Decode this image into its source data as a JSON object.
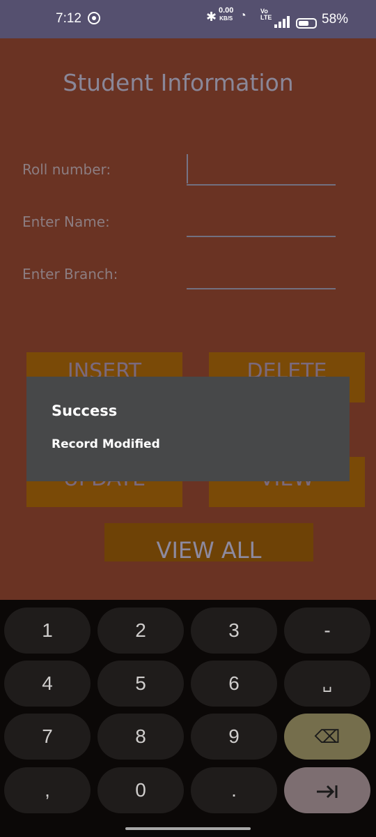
{
  "status_bar": {
    "time": "7:12",
    "net_speed_value": "0.00",
    "net_speed_unit": "KB/S",
    "volte_top": "Vo",
    "volte_bottom": "LTE",
    "battery": "58%"
  },
  "app": {
    "title": "Student Information",
    "fields": [
      {
        "label": "Roll number:",
        "value": ""
      },
      {
        "label": "Enter Name:",
        "value": ""
      },
      {
        "label": "Enter Branch:",
        "value": ""
      }
    ],
    "buttons": {
      "insert": "INSERT",
      "delete": "DELETE",
      "update": "UPDATE",
      "view": "VIEW",
      "view_all": "VIEW ALL"
    }
  },
  "dialog": {
    "title": "Success",
    "message": "Record Modified"
  },
  "keyboard": {
    "keys": [
      "1",
      "2",
      "3",
      "-",
      "4",
      "5",
      "6",
      "␣",
      "7",
      "8",
      "9",
      "⌫",
      ",",
      "0",
      "."
    ]
  },
  "colors": {
    "status_bar": "#55506f",
    "app_background": "#6a3323",
    "button": "#7a4a07",
    "dialog": "#474849",
    "keyboard": "#0b0807"
  }
}
